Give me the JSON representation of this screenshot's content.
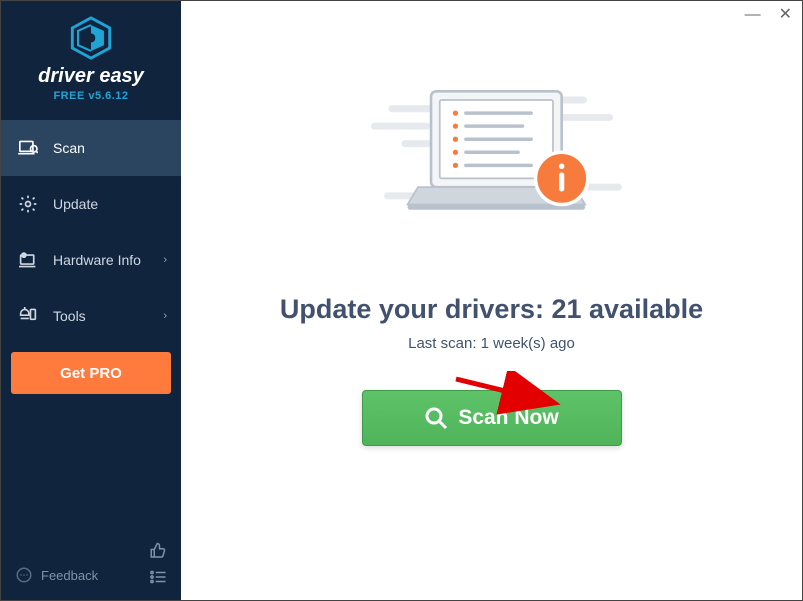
{
  "brand": {
    "name": "driver easy",
    "version_line": "FREE v5.6.12"
  },
  "sidebar": {
    "items": [
      {
        "label": "Scan"
      },
      {
        "label": "Update"
      },
      {
        "label": "Hardware Info"
      },
      {
        "label": "Tools"
      }
    ],
    "get_pro": "Get PRO",
    "feedback": "Feedback"
  },
  "main": {
    "headline_prefix": "Update your drivers: ",
    "available_count": "21",
    "headline_suffix": " available",
    "last_scan": "Last scan: 1 week(s) ago",
    "scan_button": "Scan Now"
  },
  "colors": {
    "sidebar_bg": "#10253d",
    "accent_orange": "#ff7a3d",
    "accent_green": "#4fb45a",
    "logo_teal": "#1fa4d6"
  }
}
